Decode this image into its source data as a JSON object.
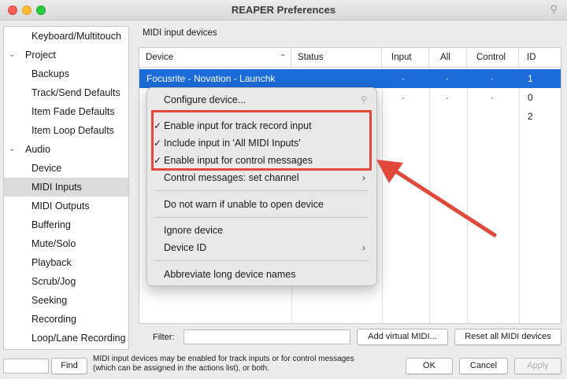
{
  "window": {
    "title": "REAPER Preferences"
  },
  "sidebar": {
    "items": [
      {
        "label": "Keyboard/Multitouch",
        "level": 1,
        "chevron": ""
      },
      {
        "label": "Project",
        "level": 0,
        "chevron": "⌄"
      },
      {
        "label": "Backups",
        "level": 1,
        "chevron": ""
      },
      {
        "label": "Track/Send Defaults",
        "level": 1,
        "chevron": ""
      },
      {
        "label": "Item Fade Defaults",
        "level": 1,
        "chevron": ""
      },
      {
        "label": "Item Loop Defaults",
        "level": 1,
        "chevron": ""
      },
      {
        "label": "Audio",
        "level": 0,
        "chevron": "⌄"
      },
      {
        "label": "Device",
        "level": 1,
        "chevron": ""
      },
      {
        "label": "MIDI Inputs",
        "level": 1,
        "chevron": "",
        "selected": true
      },
      {
        "label": "MIDI Outputs",
        "level": 1,
        "chevron": ""
      },
      {
        "label": "Buffering",
        "level": 1,
        "chevron": ""
      },
      {
        "label": "Mute/Solo",
        "level": 1,
        "chevron": ""
      },
      {
        "label": "Playback",
        "level": 1,
        "chevron": ""
      },
      {
        "label": "Scrub/Jog",
        "level": 1,
        "chevron": ""
      },
      {
        "label": "Seeking",
        "level": 1,
        "chevron": ""
      },
      {
        "label": "Recording",
        "level": 1,
        "chevron": ""
      },
      {
        "label": "Loop/Lane Recording",
        "level": 1,
        "chevron": ""
      }
    ]
  },
  "main": {
    "section_label": "MIDI input devices",
    "table": {
      "headers": {
        "device": "Device",
        "status": "Status",
        "input": "Input",
        "all": "All",
        "control": "Control",
        "id": "ID"
      },
      "sort_icon": "⌃",
      "rows": [
        {
          "device": "Focusrite - Novation - Launchk",
          "status": "",
          "input": "·",
          "all": "·",
          "control": "·",
          "id": "1",
          "selected": true
        },
        {
          "device": "",
          "status": "",
          "input": "·",
          "all": "·",
          "control": "·",
          "id": "0",
          "selected": false
        },
        {
          "device": "",
          "status": "",
          "input": "",
          "all": "",
          "control": "",
          "id": "2",
          "selected": false
        }
      ]
    },
    "filter": {
      "label": "Filter:",
      "value": ""
    },
    "add_virtual_label": "Add virtual MIDI...",
    "reset_all_label": "Reset all MIDI devices"
  },
  "context_menu": {
    "items": [
      {
        "label": "Configure device...",
        "checked": false,
        "submenu": false
      },
      {
        "label": "Enable input for track record input",
        "checked": true,
        "submenu": false
      },
      {
        "label": "Include input in 'All MIDI Inputs'",
        "checked": true,
        "submenu": false
      },
      {
        "label": "Enable input for control messages",
        "checked": true,
        "submenu": false
      },
      {
        "label": "Control messages: set channel",
        "checked": false,
        "submenu": true
      },
      {
        "label": "Do not warn if unable to open device",
        "checked": false,
        "submenu": false
      },
      {
        "label": "Ignore device",
        "checked": false,
        "submenu": false
      },
      {
        "label": "Device ID",
        "checked": false,
        "submenu": true
      },
      {
        "label": "Abbreviate long device names",
        "checked": false,
        "submenu": false
      }
    ],
    "check_glyph": "✓",
    "submenu_glyph": "›"
  },
  "footer": {
    "find_label": "Find",
    "info_line1": "MIDI input devices may be enabled for track inputs or for control messages",
    "info_line2": "(which can be assigned in the actions list), or both.",
    "ok_label": "OK",
    "cancel_label": "Cancel",
    "apply_label": "Apply"
  },
  "annotation": {
    "color": "#e0493a"
  }
}
